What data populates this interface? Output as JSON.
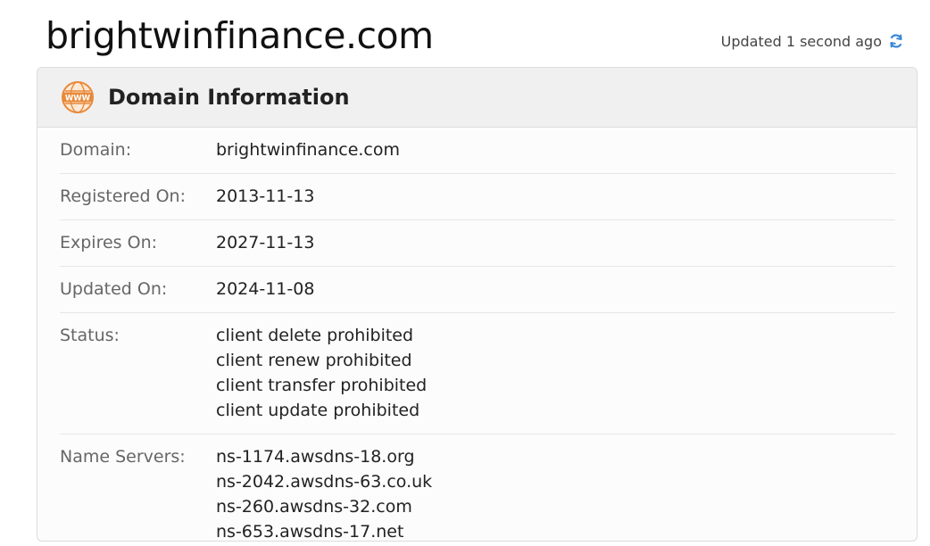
{
  "page": {
    "title": "brightwinfinance.com",
    "updated_text": "Updated 1 second ago",
    "refresh_icon": "refresh-icon"
  },
  "card": {
    "title": "Domain Information",
    "icon": "www-globe-icon",
    "accent_color": "#e8893a",
    "refresh_color": "#3a86d6"
  },
  "rows": {
    "domain": {
      "label": "Domain:",
      "value": "brightwinfinance.com"
    },
    "registered": {
      "label": "Registered On:",
      "value": "2013-11-13"
    },
    "expires": {
      "label": "Expires On:",
      "value": "2027-11-13"
    },
    "updated": {
      "label": "Updated On:",
      "value": "2024-11-08"
    },
    "status": {
      "label": "Status:",
      "values": [
        "client delete prohibited",
        "client renew prohibited",
        "client transfer prohibited",
        "client update prohibited"
      ]
    },
    "nameservers": {
      "label": "Name Servers:",
      "values": [
        "ns-1174.awsdns-18.org",
        "ns-2042.awsdns-63.co.uk",
        "ns-260.awsdns-32.com",
        "ns-653.awsdns-17.net"
      ]
    }
  }
}
